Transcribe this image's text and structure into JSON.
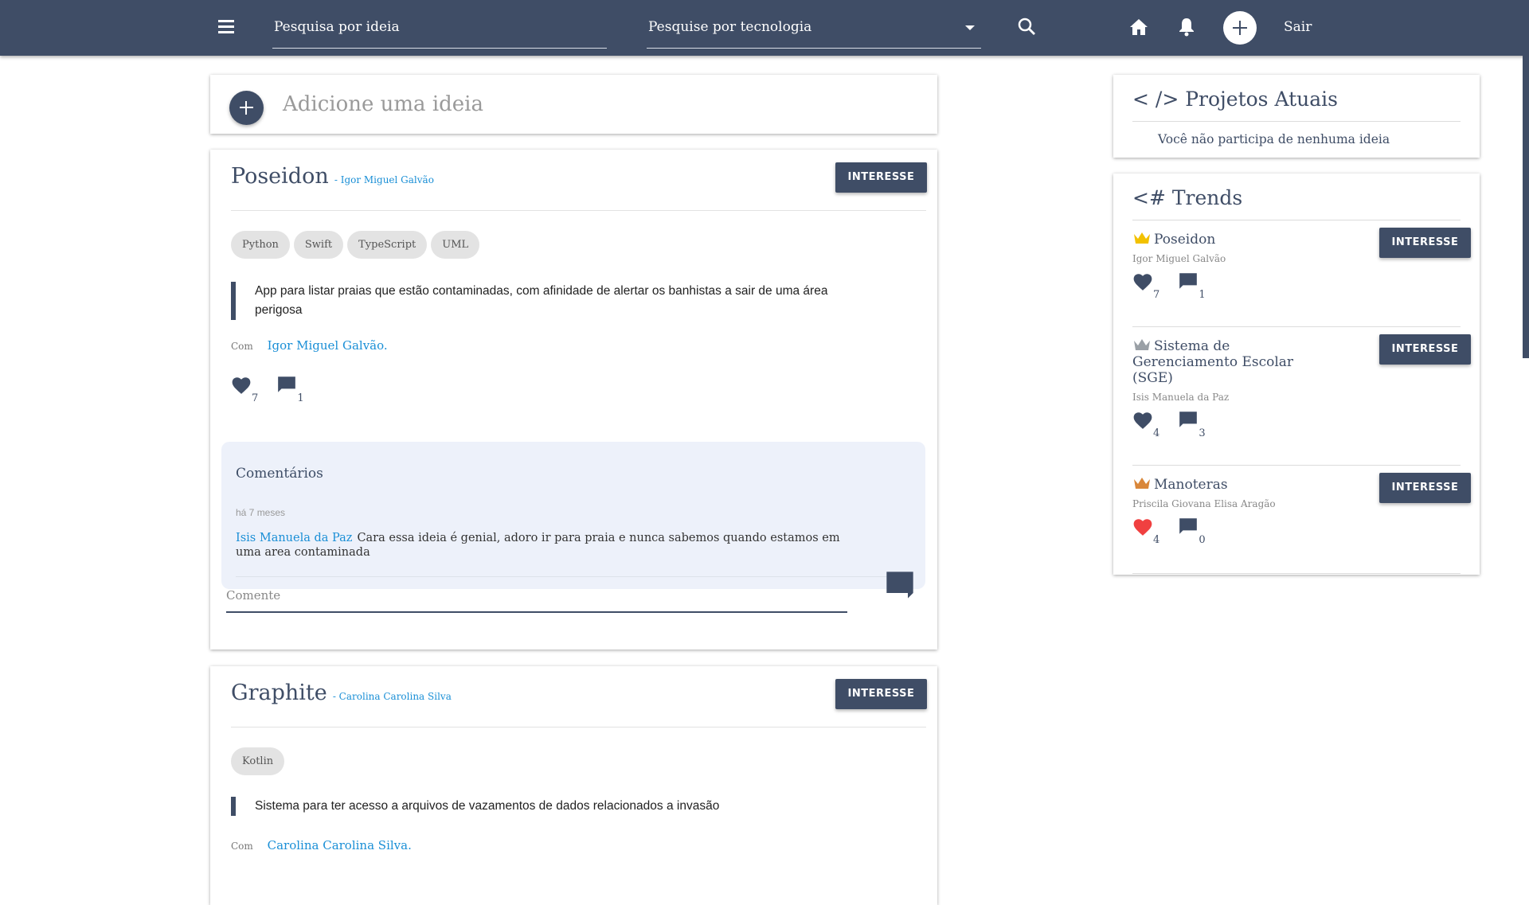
{
  "topbar": {
    "menu_icon": "menu-icon",
    "search_idea_placeholder": "Pesquisa por ideia",
    "search_tech_placeholder": "Pesquise por tecnologia",
    "logout": "Sair",
    "bg_color": "#3f4d66"
  },
  "add_idea": {
    "label": "Adicione uma ideia"
  },
  "ideas": [
    {
      "title": "Poseidon",
      "author": "- Igor Miguel Galvão",
      "interest": "INTERESSE",
      "tags": [
        "Python",
        "Swift",
        "TypeScript",
        "UML"
      ],
      "description": "App para listar praias que estão contaminadas, com afinidade de alertar os banhistas a sair de uma área perigosa",
      "with_label": "Com",
      "with_names": "Igor Miguel Galvão",
      "likes": "7",
      "comments_count": "1",
      "comments_title": "Comentários",
      "comment_time": "há 7 meses",
      "comment_author": "Isis Manuela da Paz",
      "comment_text": "Cara essa ideia é genial, adoro ir para praia e nunca sabemos quando estamos em uma area contaminada",
      "comment_placeholder": "Comente"
    },
    {
      "title": "Graphite",
      "author": "- Carolina Carolina Silva",
      "interest": "INTERESSE",
      "tags": [
        "Kotlin"
      ],
      "description": "Sistema para ter acesso a arquivos de vazamentos de dados relacionados a invasão",
      "with_label": "Com",
      "with_names": "Carolina Carolina Silva"
    }
  ],
  "projects": {
    "title": "< /> Projetos Atuais",
    "empty": "Você não participa de nenhuma ideia"
  },
  "trends": {
    "title": "<# Trends",
    "items": [
      {
        "name": "Poseidon",
        "author": "Igor Miguel Galvão",
        "likes": "7",
        "comments": "1",
        "interest": "INTERESSE",
        "crown_color": "#f2c100",
        "heart_color": "#3f4d66"
      },
      {
        "name": "Sistema de Gerenciamento Escolar (SGE)",
        "author": "Isis Manuela da Paz",
        "likes": "4",
        "comments": "3",
        "interest": "INTERESSE",
        "crown_color": "#9aa0a6",
        "heart_color": "#3f4d66"
      },
      {
        "name": "Manoteras",
        "author": "Priscila Giovana Elisa Aragão",
        "likes": "4",
        "comments": "0",
        "interest": "INTERESSE",
        "crown_color": "#d9873a",
        "heart_color": "#f04040"
      }
    ]
  }
}
